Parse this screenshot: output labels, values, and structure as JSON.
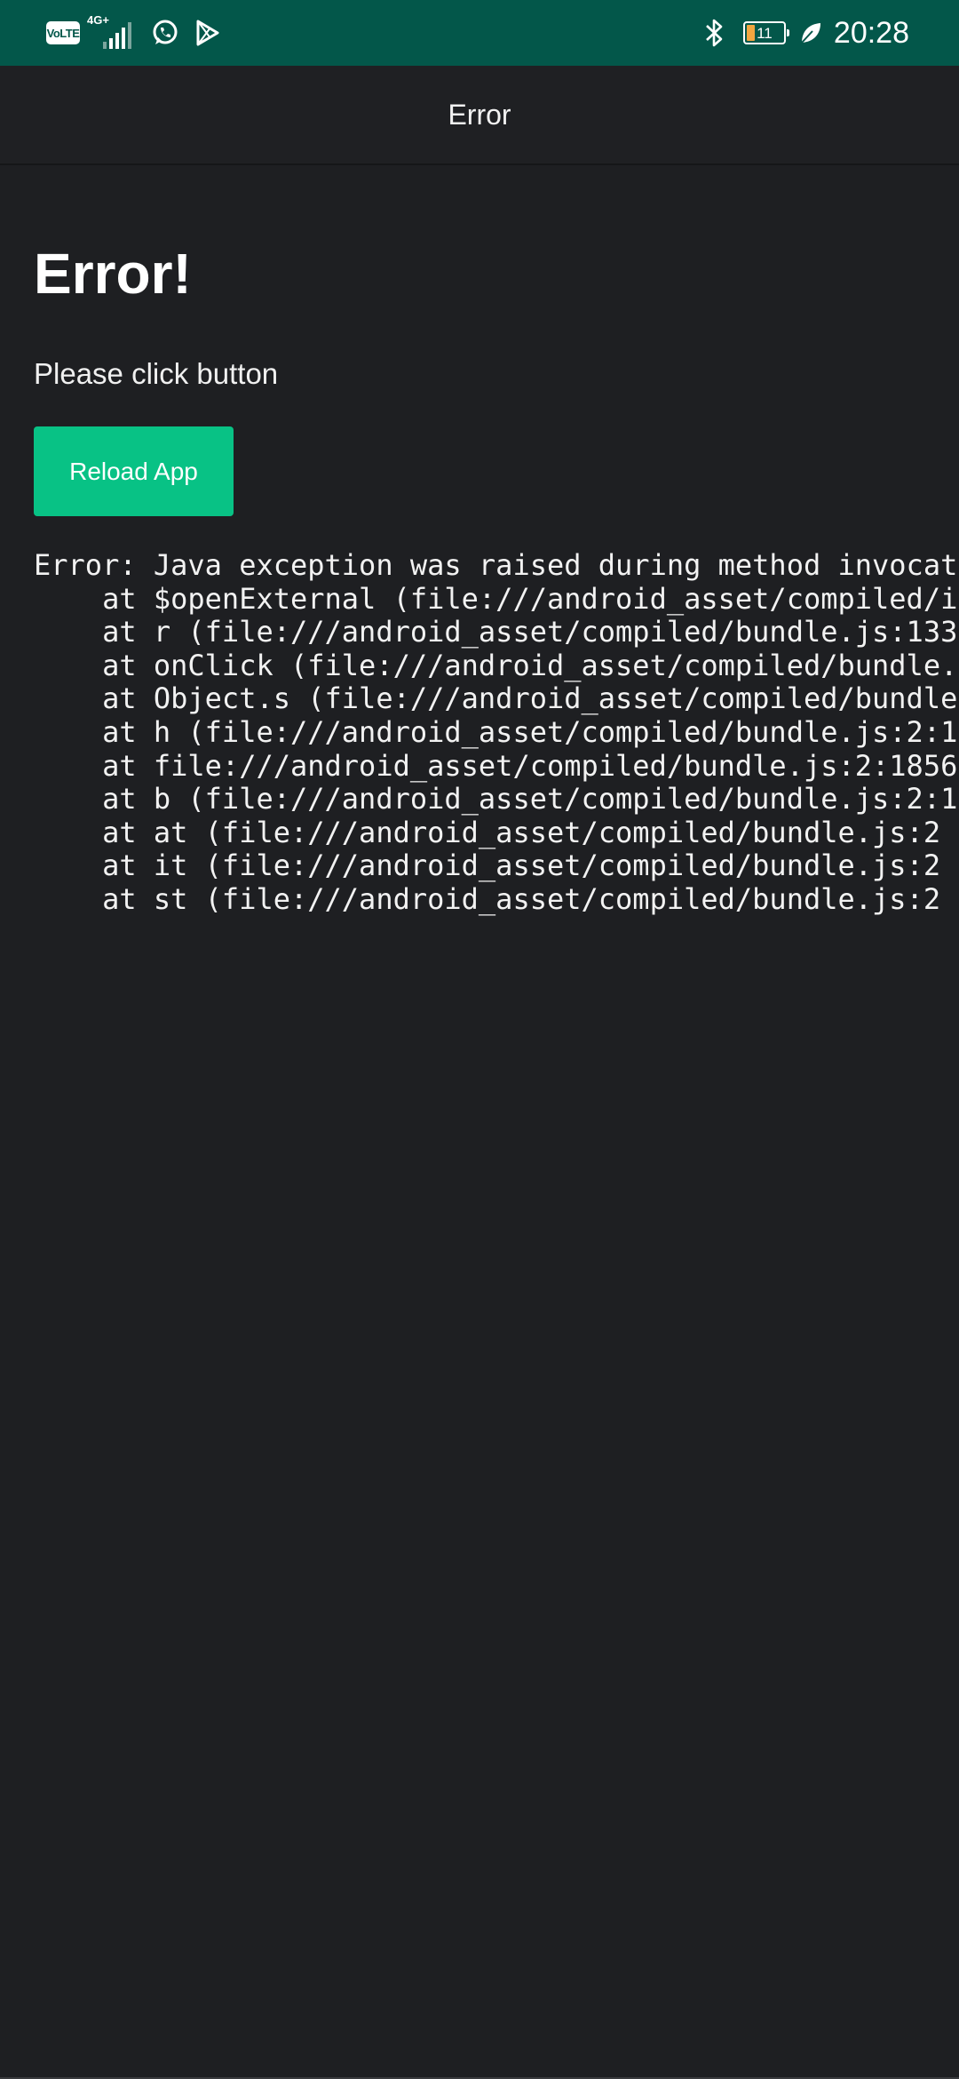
{
  "status_bar": {
    "volte_label": "VoLTE",
    "network_label": "4G+",
    "battery_level": "11",
    "time": "20:28",
    "icons": [
      "volte-icon",
      "signal-icon",
      "whatsapp-icon",
      "play-store-icon",
      "bluetooth-icon",
      "battery-icon",
      "leaf-icon"
    ]
  },
  "header": {
    "title": "Error"
  },
  "main": {
    "title": "Error!",
    "message": "Please click button",
    "reload_button_label": "Reload App",
    "stack_trace": [
      "Error: Java exception was raised during method invocat",
      "    at $openExternal (file:///android_asset/compiled/i",
      "    at r (file:///android_asset/compiled/bundle.js:133",
      "    at onClick (file:///android_asset/compiled/bundle.",
      "    at Object.s (file:///android_asset/compiled/bundle",
      "    at h (file:///android_asset/compiled/bundle.js:2:1",
      "    at file:///android_asset/compiled/bundle.js:2:1856",
      "    at b (file:///android_asset/compiled/bundle.js:2:1",
      "    at at (file:///android_asset/compiled/bundle.js:2",
      "    at it (file:///android_asset/compiled/bundle.js:2",
      "    at st (file:///android_asset/compiled/bundle.js:2"
    ]
  },
  "colors": {
    "status_bar_bg": "#03574a",
    "background": "#1e1f22",
    "button_bg": "#08c285",
    "battery_fill": "#f2a640"
  }
}
